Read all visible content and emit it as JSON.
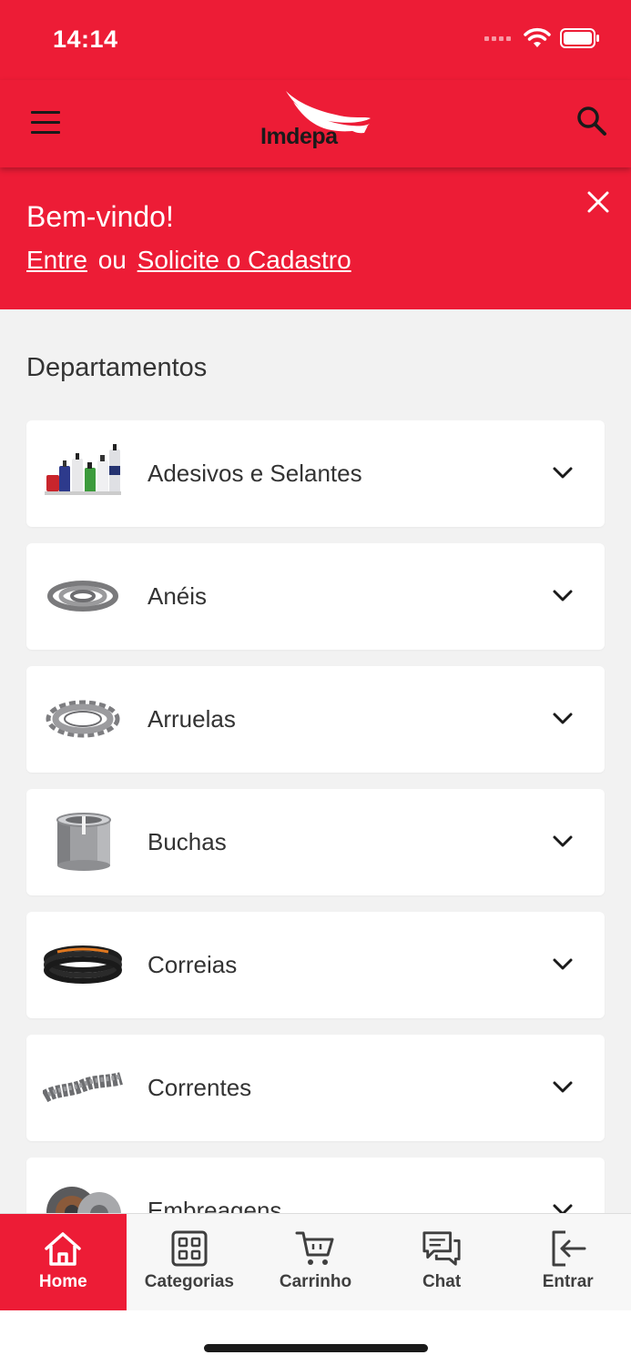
{
  "status_bar": {
    "time": "14:14"
  },
  "header": {
    "logo_text": "Imdepa"
  },
  "welcome": {
    "title": "Bem-vindo!",
    "login_link": "Entre",
    "separator": "ou",
    "register_link": "Solicite o Cadastro"
  },
  "departments": {
    "title": "Departamentos",
    "items": [
      {
        "label": "Adesivos e Selantes",
        "icon": "adhesive-bottles-icon"
      },
      {
        "label": "Anéis",
        "icon": "rings-icon"
      },
      {
        "label": "Arruelas",
        "icon": "washer-icon"
      },
      {
        "label": "Buchas",
        "icon": "bushing-icon"
      },
      {
        "label": "Correias",
        "icon": "belts-icon"
      },
      {
        "label": "Correntes",
        "icon": "chain-icon"
      },
      {
        "label": "Embreagens",
        "icon": "clutch-icon"
      }
    ]
  },
  "tabs": [
    {
      "label": "Home",
      "icon": "home-icon",
      "active": true
    },
    {
      "label": "Categorias",
      "icon": "grid-icon",
      "active": false
    },
    {
      "label": "Carrinho",
      "icon": "cart-icon",
      "active": false
    },
    {
      "label": "Chat",
      "icon": "chat-icon",
      "active": false
    },
    {
      "label": "Entrar",
      "icon": "login-icon",
      "active": false
    }
  ],
  "colors": {
    "brand_red": "#ed1c36",
    "background": "#f2f2f2"
  }
}
